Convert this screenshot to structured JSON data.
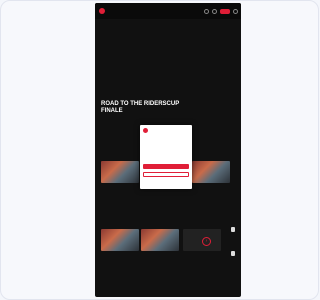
{
  "hero": {
    "kicker": "",
    "title": "ROAD TO THE RIDERSCUP FINALE",
    "body": ""
  },
  "modal": {
    "brand": "",
    "text": "",
    "primary_label": "",
    "secondary_label": "",
    "link": ""
  },
  "sections": {
    "first_title": "",
    "second_title": "",
    "second_see_all": "",
    "third_title": ""
  },
  "colors": {
    "accent": "#e01e37",
    "background": "#111111"
  }
}
